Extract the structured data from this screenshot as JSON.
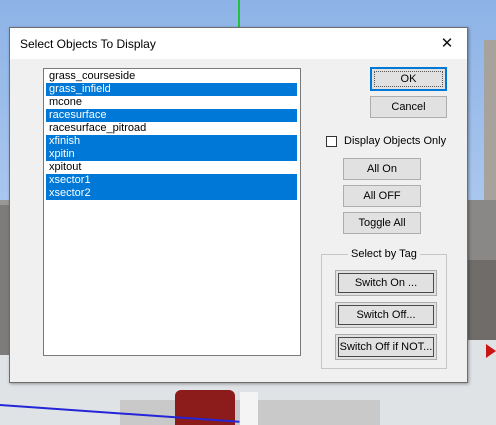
{
  "dialog": {
    "title": "Select Objects To Display",
    "close_glyph": "✕"
  },
  "objects": [
    {
      "label": "grass_courseside",
      "selected": false
    },
    {
      "label": "grass_infield",
      "selected": true
    },
    {
      "label": "mcone",
      "selected": false
    },
    {
      "label": "racesurface",
      "selected": true
    },
    {
      "label": "racesurface_pitroad",
      "selected": false
    },
    {
      "label": "xfinish",
      "selected": true
    },
    {
      "label": "xpitin",
      "selected": true
    },
    {
      "label": "xpitout",
      "selected": false
    },
    {
      "label": "xsector1",
      "selected": true
    },
    {
      "label": "xsector2",
      "selected": true
    }
  ],
  "buttons": {
    "ok": "OK",
    "cancel": "Cancel",
    "all_on": "All On",
    "all_off": "All OFF",
    "toggle_all": "Toggle All"
  },
  "display_objects_only": {
    "label": "Display Objects Only",
    "checked": false
  },
  "select_by_tag": {
    "legend": "Select by Tag",
    "switch_on": "Switch On ...",
    "switch_off": "Switch Off...",
    "switch_off_if_not": "Switch Off if NOT..."
  },
  "colors": {
    "selection": "#0078d7",
    "dialog_bg": "#f0f0f0",
    "sky": "#a9c6ee"
  }
}
